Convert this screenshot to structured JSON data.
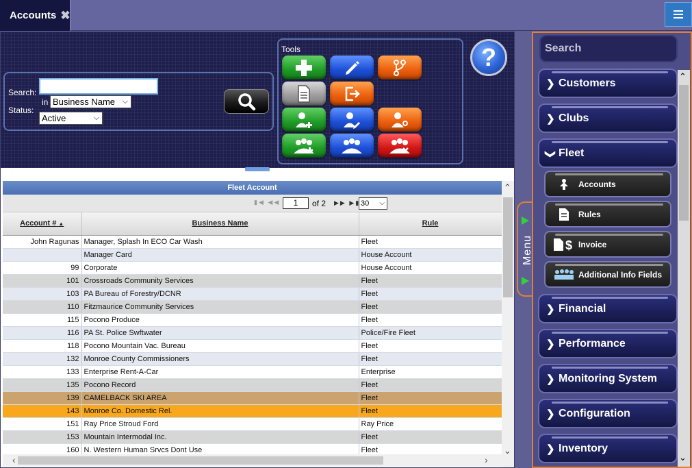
{
  "tab": {
    "title": "Accounts"
  },
  "search": {
    "search_label": "Search:",
    "search_value": "",
    "in_label": "in",
    "field_select": "Business Name",
    "status_label": "Status:",
    "status_select": "Active"
  },
  "tools": {
    "title": "Tools"
  },
  "grid": {
    "title": "Fleet Account",
    "pager": {
      "page": "1",
      "of": "of 2",
      "page_size": "30"
    },
    "columns": [
      "Account #",
      "Business Name",
      "Rule"
    ],
    "rows": [
      {
        "account": "John Ragunas",
        "name": "Manager, Splash In ECO Car Wash",
        "rule": "Fleet"
      },
      {
        "account": "",
        "name": "Manager Card",
        "rule": "House Account"
      },
      {
        "account": "99",
        "name": "Corporate",
        "rule": "House Account"
      },
      {
        "account": "101",
        "name": "Crossroads Community Services",
        "rule": "Fleet"
      },
      {
        "account": "103",
        "name": "PA Bureau of Forestry/DCNR",
        "rule": "Fleet"
      },
      {
        "account": "110",
        "name": "Fitzmaurice Community Services",
        "rule": "Fleet"
      },
      {
        "account": "115",
        "name": "Pocono Produce",
        "rule": "Fleet"
      },
      {
        "account": "116",
        "name": "PA St. Police Swftwater",
        "rule": "Police/Fire Fleet"
      },
      {
        "account": "118",
        "name": "Pocono Mountain Vac. Bureau",
        "rule": "Fleet"
      },
      {
        "account": "132",
        "name": "Monroe County Commissioners",
        "rule": "Fleet"
      },
      {
        "account": "133",
        "name": "Enterprise Rent-A-Car",
        "rule": "Enterprise"
      },
      {
        "account": "135",
        "name": "Pocono Record",
        "rule": "Fleet"
      },
      {
        "account": "139",
        "name": "CAMELBACK SKI AREA",
        "rule": "Fleet"
      },
      {
        "account": "143",
        "name": "Monroe Co. Domestic Rel.",
        "rule": "Fleet"
      },
      {
        "account": "151",
        "name": "Ray Price Stroud Ford",
        "rule": "Ray Price"
      },
      {
        "account": "153",
        "name": "Mountain Intermodal Inc.",
        "rule": "Fleet"
      },
      {
        "account": "160",
        "name": "N. Western Human Srvcs Dont Use",
        "rule": "Fleet"
      }
    ]
  },
  "menu_toggle": {
    "label": "Menu"
  },
  "sidebar": {
    "search_label": "Search",
    "items": [
      {
        "label": "Customers"
      },
      {
        "label": "Clubs"
      },
      {
        "label": "Fleet"
      },
      {
        "label": "Financial"
      },
      {
        "label": "Performance"
      },
      {
        "label": "Monitoring System"
      },
      {
        "label": "Configuration"
      },
      {
        "label": "Inventory"
      }
    ],
    "fleet_subitems": [
      {
        "label": "Accounts"
      },
      {
        "label": "Rules"
      },
      {
        "label": "Invoice"
      },
      {
        "label": "Additional Info Fields"
      }
    ]
  },
  "colors": {
    "highlight_selected": "#f9a81e",
    "highlight_hover": "#caa36e",
    "sidebar_border": "#e07f3a",
    "menu_arrow": "#32d23a"
  }
}
